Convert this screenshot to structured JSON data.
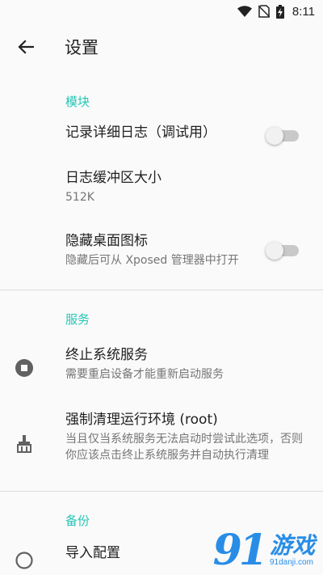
{
  "status_bar": {
    "time": "8:11",
    "icons": [
      "wifi-icon",
      "no-sim-icon",
      "battery-charging-icon"
    ]
  },
  "app_bar": {
    "back_icon": "arrow-left-icon",
    "title": "设置"
  },
  "sections": {
    "module": {
      "header": "模块",
      "items": {
        "verbose_log": {
          "title": "记录详细日志（调试用）",
          "switch_on": false
        },
        "log_buffer": {
          "title": "日志缓冲区大小",
          "summary": "512K"
        },
        "hide_icon": {
          "title": "隐藏桌面图标",
          "summary": "隐藏后可从 Xposed 管理器中打开",
          "switch_on": false
        }
      }
    },
    "service": {
      "header": "服务",
      "items": {
        "stop_service": {
          "title": "终止系统服务",
          "summary": "需要重启设备才能重新启动服务",
          "icon": "stop-circle-icon"
        },
        "force_clean": {
          "title": "强制清理运行环境 (root)",
          "summary": "当且仅当系统服务无法启动时尝试此选项，否则你应该点击终止系统服务并自动执行清理",
          "icon": "broom-icon"
        }
      }
    },
    "backup": {
      "header": "备份",
      "items": {
        "import_config": {
          "title": "导入配置",
          "icon": "import-icon"
        }
      }
    }
  },
  "watermark": {
    "number": "9",
    "number2": "1",
    "text": "游戏",
    "site": "91danji.com"
  },
  "colors": {
    "accent": "#26c6b7",
    "switch_track": "#c9c9c9",
    "switch_thumb": "#f1f1f1",
    "watermark": "#1e88e5"
  }
}
